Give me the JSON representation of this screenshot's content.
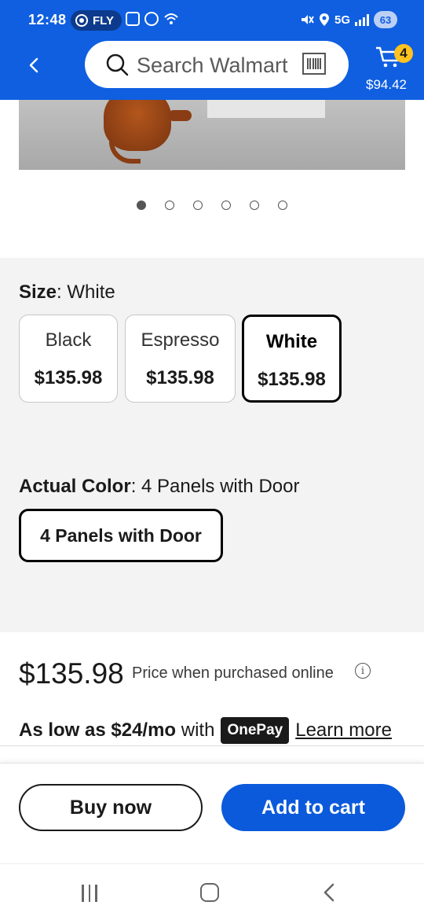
{
  "status_bar": {
    "time": "12:48",
    "carrier": "FLY",
    "network": "5G",
    "battery": "63"
  },
  "header": {
    "back_icon": "chevron-left-icon",
    "search_placeholder": "Search Walmart",
    "cart_count": "4",
    "cart_total": "$94.42",
    "brand_color": "#0f5fe0",
    "badge_color": "#ffc220"
  },
  "gallery": {
    "image_count": 6,
    "active_index": 0
  },
  "size": {
    "label": "Size",
    "selected": "White",
    "options": [
      {
        "name": "Black",
        "price": "$135.98",
        "selected": false
      },
      {
        "name": "Espresso",
        "price": "$135.98",
        "selected": false
      },
      {
        "name": "White",
        "price": "$135.98",
        "selected": true
      }
    ]
  },
  "actual_color": {
    "label": "Actual Color",
    "selected": "4 Panels with Door",
    "options": [
      "4 Panels with Door"
    ]
  },
  "price": {
    "amount": "$135.98",
    "note": "Price when purchased online",
    "info_icon": "info-icon",
    "low_as_prefix": "As low as $24/mo",
    "low_as_with": "with",
    "onepay": "OnePay",
    "learn_more": "Learn more"
  },
  "actions": {
    "buy_now": "Buy now",
    "add_to_cart": "Add to cart",
    "accent": "#0a5adb"
  },
  "nav": {
    "recent_icon": "recent-apps-icon",
    "home_icon": "home-icon",
    "back_icon": "back-icon"
  }
}
